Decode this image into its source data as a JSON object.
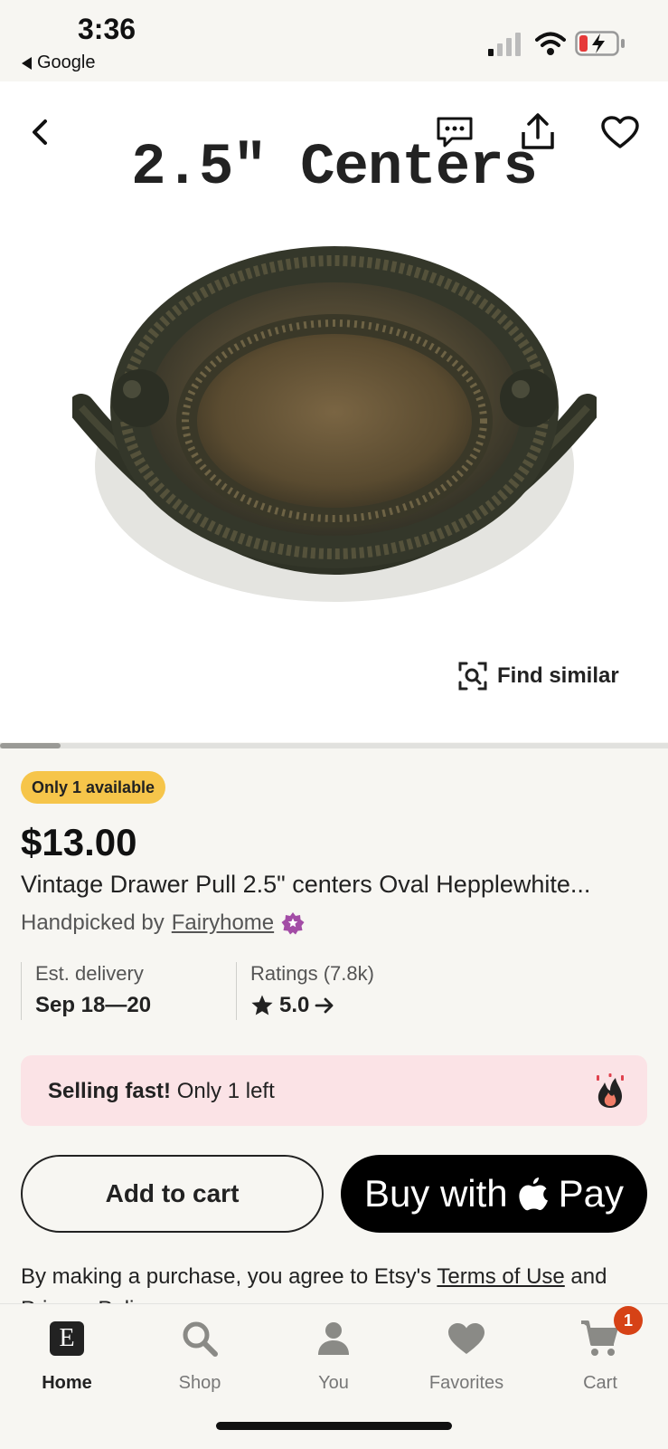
{
  "status_bar": {
    "time": "3:36",
    "back_app": "Google"
  },
  "gallery": {
    "overlay_text": "2.5\" Centers",
    "find_similar_label": "Find similar",
    "progress": 0.09
  },
  "product": {
    "availability_badge": "Only 1 available",
    "price": "$13.00",
    "title": "Vintage Drawer Pull 2.5\" centers Oval Hepplewhite...",
    "handpicked_prefix": "Handpicked by",
    "shop_name": "Fairyhome"
  },
  "delivery": {
    "label": "Est. delivery",
    "value": "Sep 18—20"
  },
  "ratings": {
    "label": "Ratings (7.8k)",
    "value": "5.0"
  },
  "selling_fast": {
    "bold": "Selling fast!",
    "text": " Only 1 left"
  },
  "actions": {
    "add_to_cart": "Add to cart",
    "buy_with": "Buy with",
    "pay": "Pay"
  },
  "terms": {
    "prefix": "By making a purchase, you agree to Etsy's ",
    "terms_link": "Terms of Use",
    "middle": " and",
    "privacy_link": "Privacy Policy"
  },
  "tabbar": {
    "tabs": [
      {
        "label": "Home",
        "icon": "etsy-logo-icon"
      },
      {
        "label": "Shop",
        "icon": "search-icon"
      },
      {
        "label": "You",
        "icon": "user-icon"
      },
      {
        "label": "Favorites",
        "icon": "heart-icon"
      },
      {
        "label": "Cart",
        "icon": "cart-icon"
      }
    ],
    "cart_count": "1",
    "home_logo_letter": "E"
  },
  "colors": {
    "badge_yellow": "#f6c54a",
    "selling_bg": "#fbe3e6",
    "cart_badge": "#d64216",
    "star": "#222222"
  }
}
